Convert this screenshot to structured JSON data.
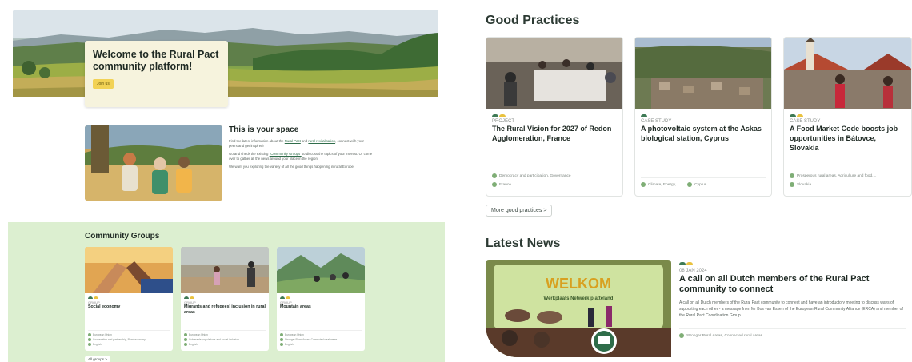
{
  "hero": {
    "title": "Welcome to the Rural Pact community platform!",
    "button_label": "Join us"
  },
  "space": {
    "title": "This is your space",
    "p1_before": "Find the latest information about the ",
    "p1_link1": "Rural Pact",
    "p1_middle": " and ",
    "p1_link2": "rural revitalisation",
    "p1_after": ", connect with your peers and get inspired!",
    "p2_before": "Go and check the existing ",
    "p2_link": "\"Community Groups\"",
    "p2_after": " to discuss the topics of your interest. Or come over to gather all the news around your place in the region.",
    "p3": "We want you exploring the variety of all the good things happening in rural Europe."
  },
  "groups": {
    "title": "Community Groups",
    "all_label": "All groups  >",
    "cards": [
      {
        "type": "GROUP",
        "title": "Social economy",
        "tags": [
          "European Union",
          "Cooperation and partnership, Rural economy",
          "English"
        ]
      },
      {
        "type": "GROUP",
        "title": "Migrants and refugees' inclusion in rural areas",
        "tags": [
          "European Union",
          "Vulnerable populations and social inclusion",
          "English"
        ]
      },
      {
        "type": "GROUP",
        "title": "Mountain areas",
        "tags": [
          "European Union",
          "Stronger Rural Areas, Connected rural areas",
          "English"
        ]
      }
    ]
  },
  "good_practices": {
    "title": "Good Practices",
    "more_label": "More good practices  >",
    "cards": [
      {
        "type": "PROJECT",
        "title": "The Rural Vision for 2027 of Redon Agglomeration, France",
        "tags": [
          "Democracy and participation, Governance",
          "France"
        ]
      },
      {
        "type": "CASE STUDY",
        "title": "A photovoltaic system at the Askas biological station, Cyprus",
        "tags": [
          "Climate, Energy,...",
          "Cyprus"
        ]
      },
      {
        "type": "CASE STUDY",
        "title": "A Food Market Code boosts job opportunities in Bátovce, Slovakia",
        "tags": [
          "Prosperous rural areas, Agriculture and food,...",
          "Slovakia"
        ]
      }
    ]
  },
  "news": {
    "title": "Latest News",
    "date": "08 JAN 2024",
    "headline": "A call on all Dutch members of the Rural Pact community to connect",
    "excerpt": "A call on all Dutch members of the Rural Pact community to connect and have an introductory meeting to discuss ways of supporting each other - a message from Mr Bos van Essen of the European Rural Community Alliance (ERCA) and member of the Rural Pact Coordination Group.",
    "tags": "Stronger Rural Areas, Connected rural areas",
    "image_sign_1": "WELKOM",
    "image_sign_2": "Werkplaats Netwerk platteland"
  },
  "colors": {
    "groups_bg": "#dcefd0",
    "accent_green": "#2f6d4a",
    "dot_green": "#3e7a55",
    "dot_yellow": "#e9c23f",
    "button_yellow": "#f2d255"
  }
}
